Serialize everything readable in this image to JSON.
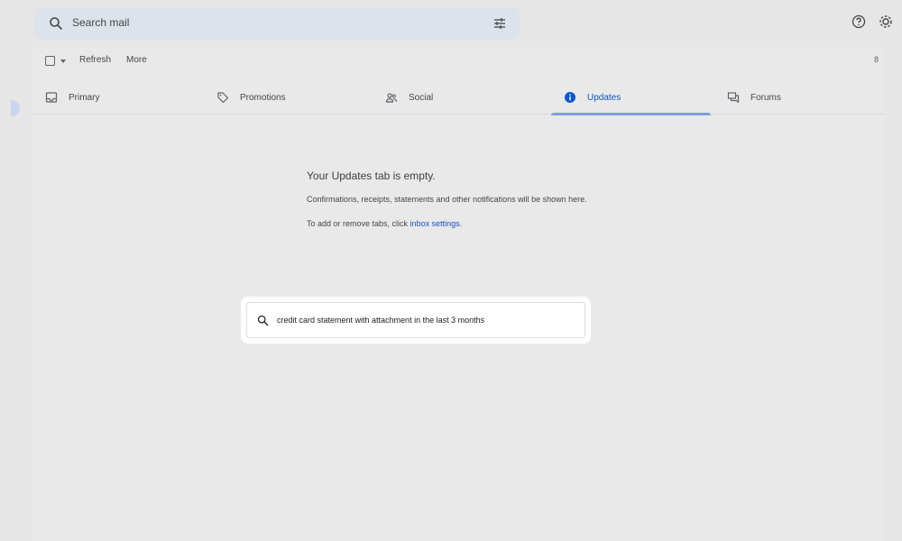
{
  "search": {
    "placeholder": "Search mail"
  },
  "toolbar": {
    "refresh_label": "Refresh",
    "more_label": "More",
    "right_truncated": "8"
  },
  "tabs": [
    {
      "label": "Primary",
      "icon": "inbox-icon"
    },
    {
      "label": "Promotions",
      "icon": "tag-icon"
    },
    {
      "label": "Social",
      "icon": "people-icon"
    },
    {
      "label": "Updates",
      "icon": "info-icon",
      "selected": true
    },
    {
      "label": "Forums",
      "icon": "forum-icon"
    }
  ],
  "empty_state": {
    "title": "Your Updates tab is empty.",
    "description": "Confirmations, receipts, statements and other notifications will be shown here.",
    "settings_prefix": "To add or remove tabs, click ",
    "settings_link": "inbox settings",
    "settings_suffix": "."
  },
  "suggestion": {
    "text": "credit card statement with attachment in the last 3 months"
  },
  "colors": {
    "accent": "#0b57d0",
    "search_bg": "#dde3ea",
    "panel_bg": "#e9e9e9"
  }
}
